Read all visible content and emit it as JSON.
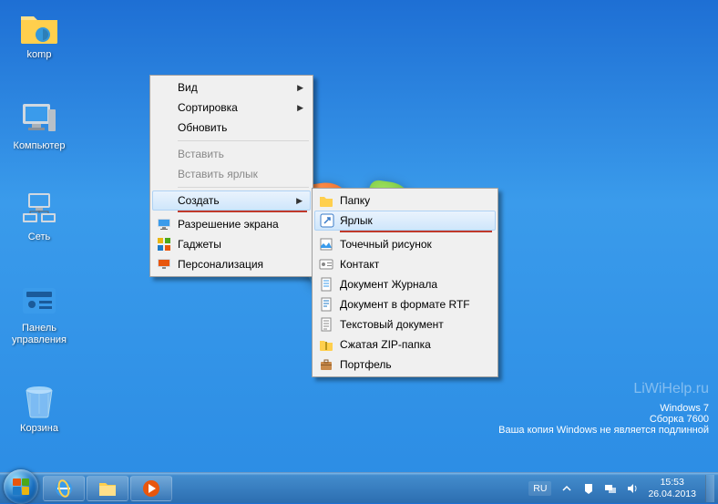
{
  "desktop_icons": {
    "komp": "komp",
    "computer": "Компьютер",
    "network": "Сеть",
    "control_panel": "Панель управления",
    "recycle_bin": "Корзина"
  },
  "context_menu": {
    "view": "Вид",
    "sort": "Сортировка",
    "refresh": "Обновить",
    "paste": "Вставить",
    "paste_shortcut": "Вставить ярлык",
    "create": "Создать",
    "screen_resolution": "Разрешение экрана",
    "gadgets": "Гаджеты",
    "personalize": "Персонализация"
  },
  "submenu": {
    "folder": "Папку",
    "shortcut": "Ярлык",
    "bitmap": "Точечный рисунок",
    "contact": "Контакт",
    "journal": "Документ Журнала",
    "rtf": "Документ в формате RTF",
    "text": "Текстовый документ",
    "zip": "Сжатая ZIP-папка",
    "briefcase": "Портфель"
  },
  "watermark": {
    "site": "LiWiHelp.ru",
    "line1": "Windows 7",
    "line2": "Сборка 7600",
    "line3": "Ваша копия Windows не является подлинной"
  },
  "tray": {
    "lang": "RU",
    "time": "15:53",
    "date": "26.04.2013"
  }
}
